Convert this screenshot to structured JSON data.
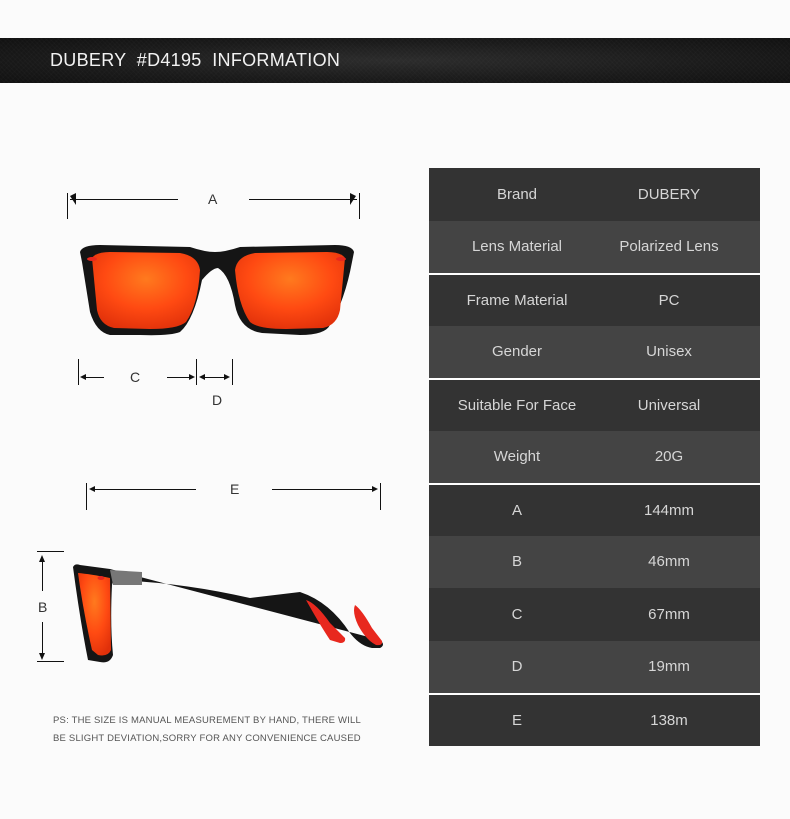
{
  "banner": {
    "title": "DUBERY  #D4195  INFORMATION"
  },
  "diagram": {
    "labels": {
      "A": "A",
      "B": "B",
      "C": "C",
      "D": "D",
      "E": "E"
    }
  },
  "specs": [
    {
      "key": "Brand",
      "value": "DUBERY"
    },
    {
      "key": "Lens Material",
      "value": "Polarized Lens"
    },
    {
      "key": "Frame Material",
      "value": "PC"
    },
    {
      "key": "Gender",
      "value": "Unisex"
    },
    {
      "key": "Suitable For Face",
      "value": "Universal"
    },
    {
      "key": "Weight",
      "value": "20G"
    },
    {
      "key": "A",
      "value": "144mm"
    },
    {
      "key": "B",
      "value": "46mm"
    },
    {
      "key": "C",
      "value": "67mm"
    },
    {
      "key": "D",
      "value": "19mm"
    },
    {
      "key": "E",
      "value": "138m"
    }
  ],
  "note": {
    "line1": "PS: THE SIZE IS MANUAL MEASUREMENT BY HAND, THERE WILL",
    "line2": "BE SLIGHT DEVIATION,SORRY FOR ANY CONVENIENCE CAUSED"
  },
  "colors": {
    "lens": "#ff4a12",
    "frame": "#1a1a1a",
    "accent": "#e8281e"
  }
}
